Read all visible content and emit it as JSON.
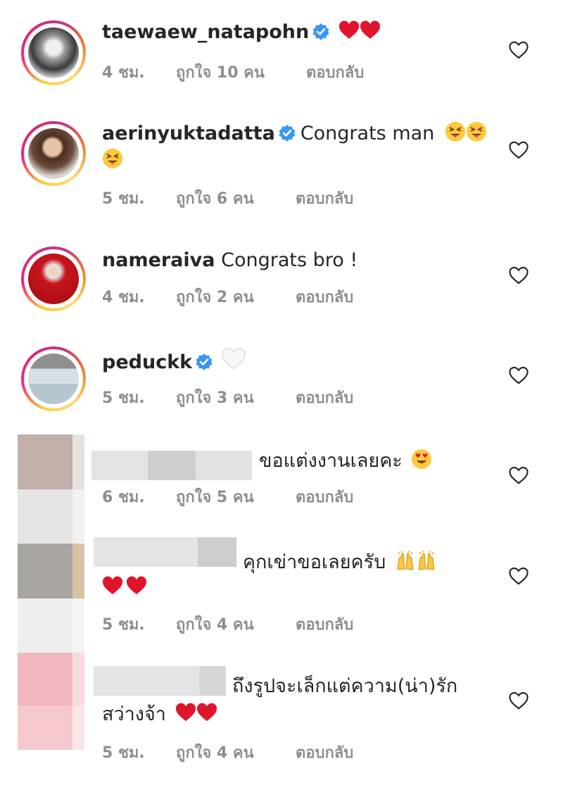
{
  "comments": [
    {
      "username": "taewaew_natapohn",
      "text": "",
      "emoji_text": "❤️❤️",
      "time": "4 ชม.",
      "likes": "ถูกใจ 10 คน",
      "reply": "ตอบกลับ",
      "verified": true
    },
    {
      "username": "aerinyuktadatta",
      "text": "Congrats man",
      "emoji_text": "😝😝😝",
      "time": "5 ชม.",
      "likes": "ถูกใจ 6 คน",
      "reply": "ตอบกลับ",
      "verified": true
    },
    {
      "username": "nameraiva",
      "text": "Congrats bro !",
      "time": "4 ชม.",
      "likes": "ถูกใจ 2 คน",
      "reply": "ตอบกลับ",
      "verified": false
    },
    {
      "username": "peduckk",
      "text": "",
      "emoji_text": "🤍",
      "time": "5 ชม.",
      "likes": "ถูกใจ 3 คน",
      "reply": "ตอบกลับ",
      "verified": true
    },
    {
      "username": "",
      "text": "ขอแต่งงานเลยคะ",
      "emoji_text": "😍",
      "time": "6 ชม.",
      "likes": "ถูกใจ 5 คน",
      "reply": "ตอบกลับ",
      "verified": false
    },
    {
      "username": "",
      "text": "คุกเข่าขอเลยครับ",
      "emoji_text": "🙌🙌❤️❤️",
      "time": "5 ชม.",
      "likes": "ถูกใจ 4 คน",
      "reply": "ตอบกลับ",
      "verified": false
    },
    {
      "username": "",
      "text": "ถึงรูปจะเล็กแต่ความ(น่า)รัก",
      "text2": "สว่างจ้า",
      "emoji_text": "❤️❤️",
      "time": "5 ชม.",
      "likes": "ถูกใจ 4 คน",
      "reply": "ตอบกลับ",
      "verified": false
    }
  ],
  "colors": {
    "verified_blue": "#3897f0",
    "meta_gray": "#8e8e8e",
    "heart_red": "#e0142a"
  },
  "icons": {
    "like": "heart-outline-icon",
    "verified": "verified-badge-icon"
  }
}
